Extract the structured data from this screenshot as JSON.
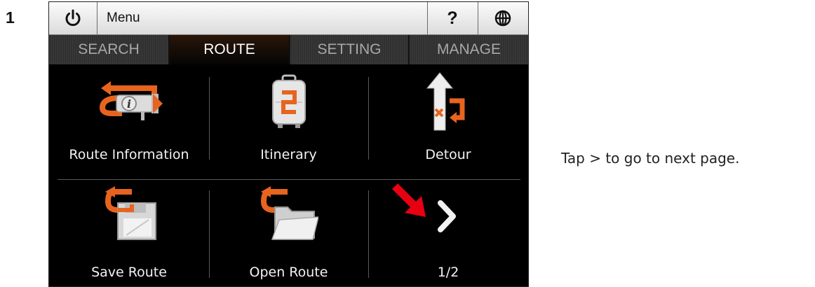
{
  "step": {
    "number": "1"
  },
  "topbar": {
    "power_icon": "power-icon",
    "menu_label": "Menu",
    "help_label": "?",
    "globe_icon": "globe-icon"
  },
  "tabs": [
    {
      "label": "SEARCH",
      "active": false
    },
    {
      "label": "ROUTE",
      "active": true
    },
    {
      "label": "SETTING",
      "active": false
    },
    {
      "label": "MANAGE",
      "active": false
    }
  ],
  "grid": {
    "items": [
      {
        "label": "Route Information",
        "icon": "route-information-icon"
      },
      {
        "label": "Itinerary",
        "icon": "itinerary-icon"
      },
      {
        "label": "Detour",
        "icon": "detour-icon"
      },
      {
        "label": "Save Route",
        "icon": "save-route-icon"
      },
      {
        "label": "Open Route",
        "icon": "open-route-icon"
      },
      {
        "label": "1/2",
        "icon": "next-page-icon"
      }
    ],
    "pointer_icon": "red-arrow-pointer-icon"
  },
  "caption": "Tap > to go to next page.",
  "colors": {
    "accent": "#e8641e",
    "pointer": "#e60012",
    "background": "#000000"
  }
}
